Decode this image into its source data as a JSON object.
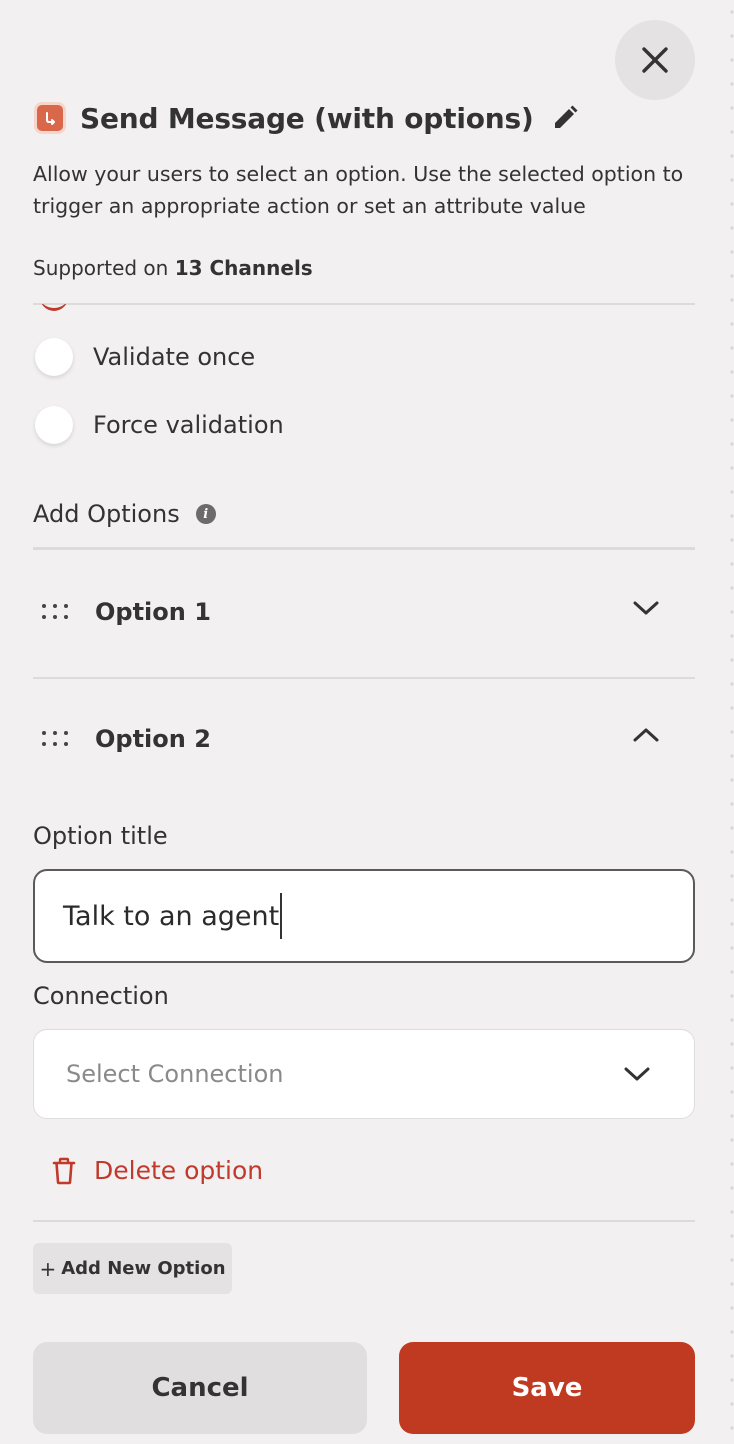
{
  "dialog": {
    "title": "Send Message (with options)",
    "description": "Allow your users to select an option. Use the selected option to trigger an appropriate action or set an attribute value",
    "supported_prefix": "Supported on ",
    "supported_count": "13 Channels",
    "icons": {
      "app": "message-options-icon",
      "edit": "pencil-icon",
      "close": "close-icon"
    }
  },
  "validation": {
    "options": [
      {
        "label": "Validate once",
        "selected": false
      },
      {
        "label": "Force validation",
        "selected": false
      }
    ]
  },
  "add_options": {
    "title": "Add Options",
    "items": [
      {
        "label": "Option 1",
        "expanded": false
      },
      {
        "label": "Option 2",
        "expanded": true
      }
    ]
  },
  "option_editor": {
    "title_label": "Option title",
    "title_value": "Talk to an agent",
    "connection_label": "Connection",
    "connection_placeholder": "Select Connection",
    "delete_label": "Delete option"
  },
  "actions": {
    "add_new_option": "Add New Option",
    "add_new_prefix": "+",
    "cancel": "Cancel",
    "save": "Save"
  },
  "colors": {
    "accent": "#c03a22",
    "background": "#f2f0f1",
    "danger": "#c0392b"
  }
}
